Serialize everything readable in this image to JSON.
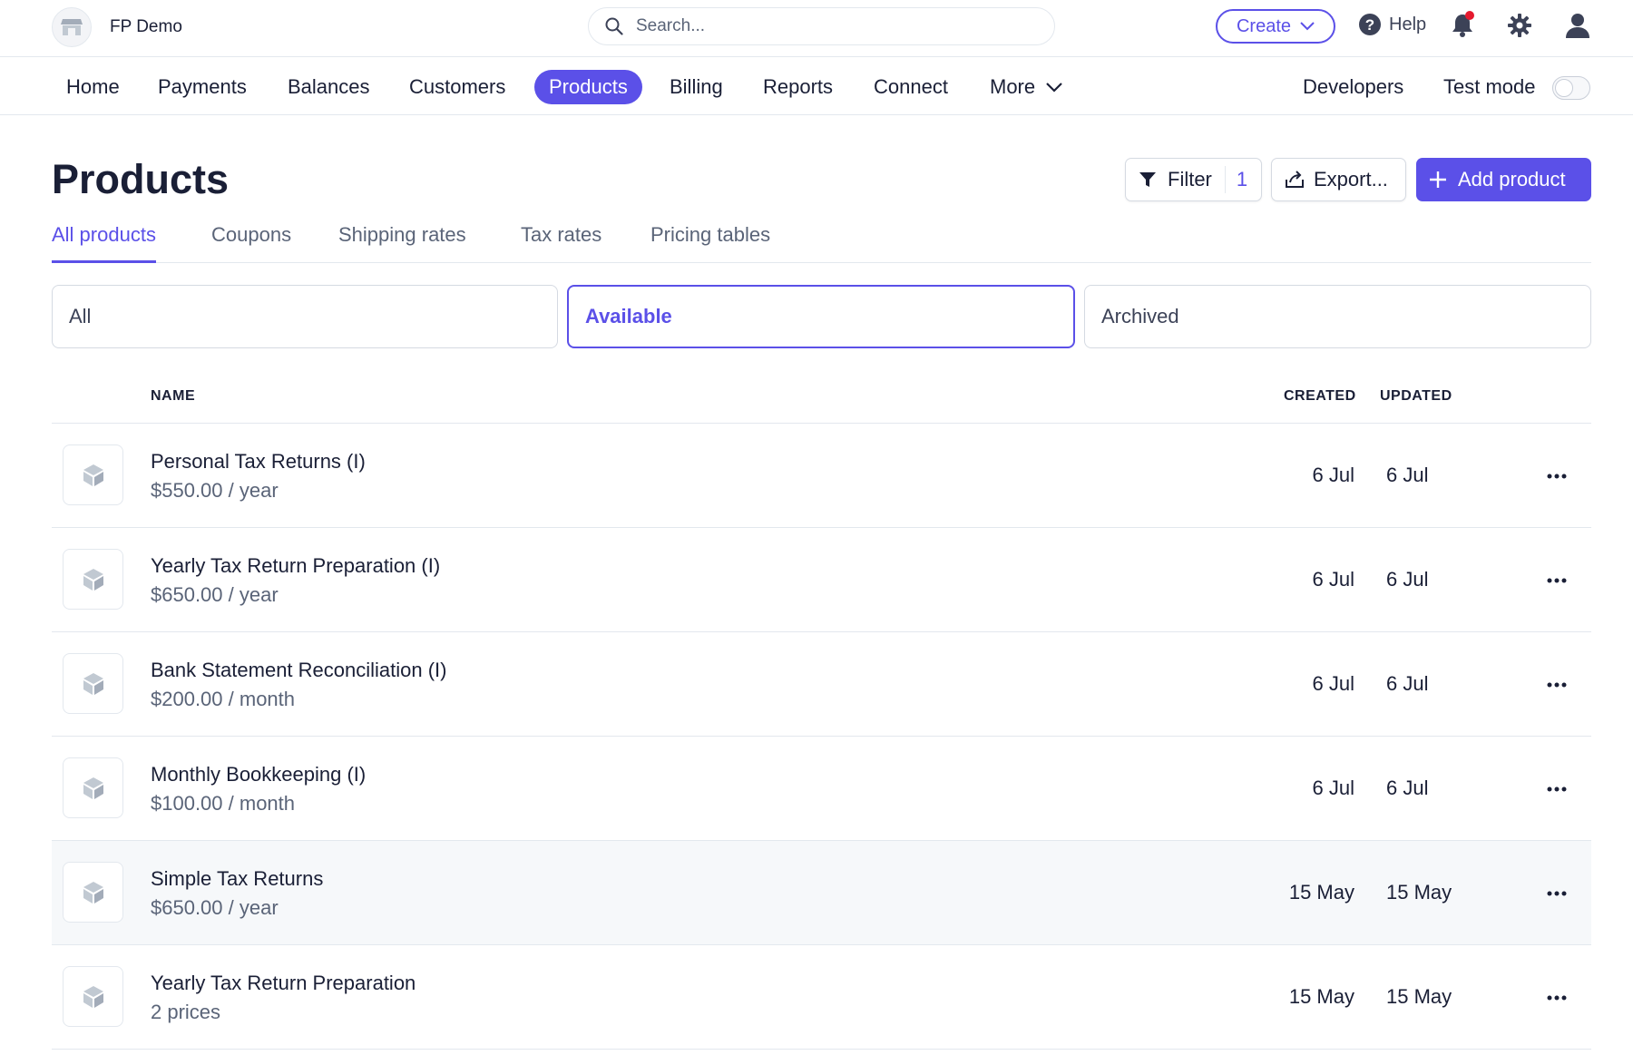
{
  "account": {
    "name": "FP Demo"
  },
  "search": {
    "placeholder": "Search..."
  },
  "topbar": {
    "create_label": "Create",
    "help_label": "Help"
  },
  "nav": {
    "items": [
      "Home",
      "Payments",
      "Balances",
      "Customers",
      "Products",
      "Billing",
      "Reports",
      "Connect",
      "More"
    ],
    "active": "Products",
    "developers_label": "Developers",
    "test_mode_label": "Test mode",
    "test_mode_on": false
  },
  "page": {
    "title": "Products",
    "filter_label": "Filter",
    "filter_count": "1",
    "export_label": "Export...",
    "add_label": "Add product"
  },
  "tabs": [
    "All products",
    "Coupons",
    "Shipping rates",
    "Tax rates",
    "Pricing tables"
  ],
  "segments": [
    "All",
    "Available",
    "Archived"
  ],
  "table": {
    "headers": {
      "name": "NAME",
      "created": "CREATED",
      "updated": "UPDATED"
    },
    "rows": [
      {
        "name": "Personal Tax Returns (I)",
        "price": "$550.00 / year",
        "created": "6 Jul",
        "updated": "6 Jul"
      },
      {
        "name": "Yearly Tax Return Preparation (I)",
        "price": "$650.00 / year",
        "created": "6 Jul",
        "updated": "6 Jul"
      },
      {
        "name": "Bank Statement Reconciliation (I)",
        "price": "$200.00 / month",
        "created": "6 Jul",
        "updated": "6 Jul"
      },
      {
        "name": "Monthly Bookkeeping (I)",
        "price": "$100.00 / month",
        "created": "6 Jul",
        "updated": "6 Jul"
      },
      {
        "name": "Simple Tax Returns",
        "price": "$650.00 / year",
        "created": "15 May",
        "updated": "15 May"
      },
      {
        "name": "Yearly Tax Return Preparation",
        "price": "2 prices",
        "created": "15 May",
        "updated": "15 May"
      }
    ]
  },
  "colors": {
    "accent": "#5b50e8",
    "notification": "#e5192e",
    "text": "#1a1f36",
    "muted": "#5a6478",
    "border": "#e3e8ee"
  }
}
